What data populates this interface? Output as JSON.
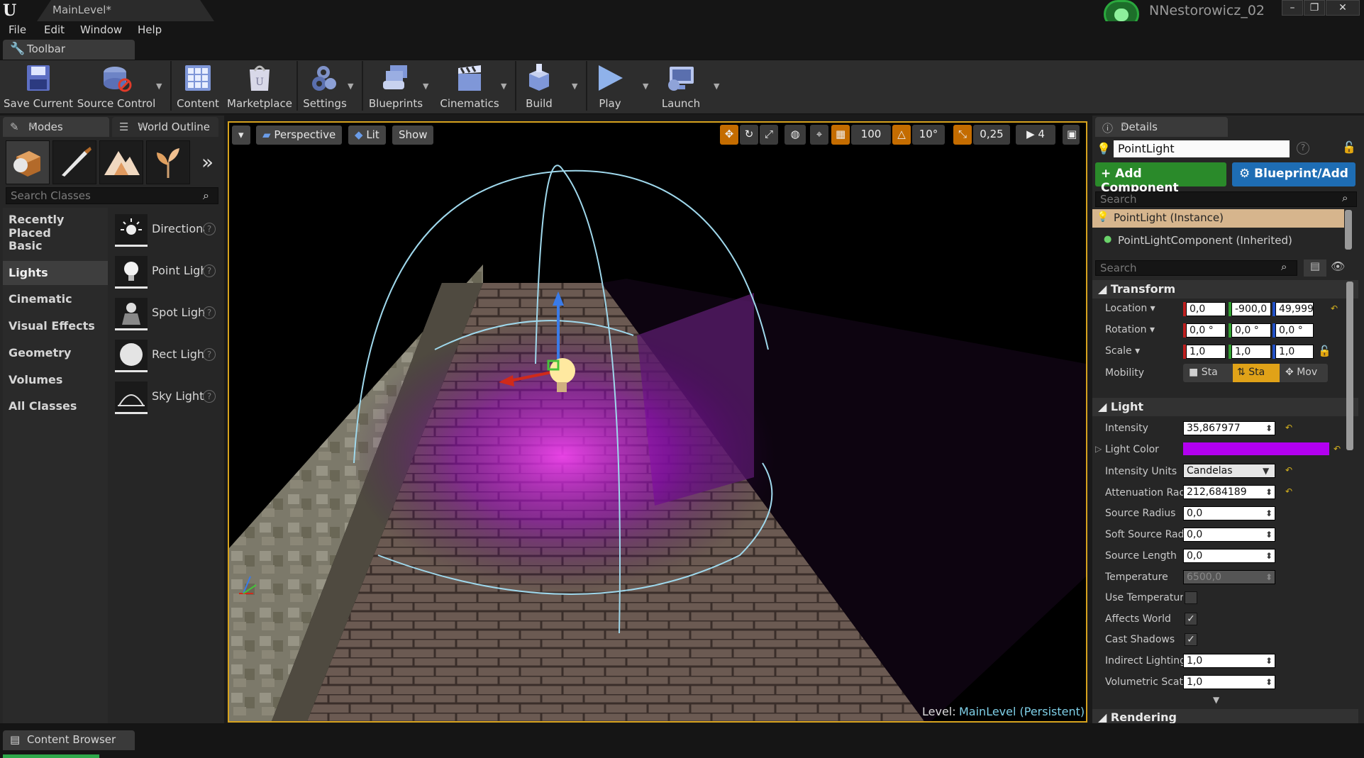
{
  "app": {
    "level_tab": "MainLevel*",
    "user_name": "NNestorowicz_02",
    "window_buttons": [
      "–",
      "❐",
      "✕"
    ]
  },
  "menu": [
    "File",
    "Edit",
    "Window",
    "Help"
  ],
  "toolbar": {
    "tab_label": "Toolbar",
    "buttons": [
      {
        "label": "Save Current",
        "icon": "save-icon"
      },
      {
        "label": "Source Control",
        "icon": "source-control-icon"
      },
      {
        "label": "Content",
        "icon": "content-icon"
      },
      {
        "label": "Marketplace",
        "icon": "marketplace-icon"
      },
      {
        "label": "Settings",
        "icon": "settings-icon"
      },
      {
        "label": "Blueprints",
        "icon": "blueprints-icon"
      },
      {
        "label": "Cinematics",
        "icon": "cinematics-icon"
      },
      {
        "label": "Build",
        "icon": "build-icon"
      },
      {
        "label": "Play",
        "icon": "play-icon"
      },
      {
        "label": "Launch",
        "icon": "launch-icon"
      }
    ]
  },
  "modes": {
    "tab_modes": "Modes",
    "tab_outliner": "World Outline",
    "search_placeholder": "Search Classes",
    "categories": [
      "Recently Placed",
      "Basic",
      "Lights",
      "Cinematic",
      "Visual Effects",
      "Geometry",
      "Volumes",
      "All Classes"
    ],
    "selected_category": "Lights",
    "lights": [
      {
        "name": "Directional Light",
        "icon": "directional-light-icon"
      },
      {
        "name": "Point Light",
        "icon": "point-light-icon"
      },
      {
        "name": "Spot Light",
        "icon": "spot-light-icon"
      },
      {
        "name": "Rect Light",
        "icon": "rect-light-icon"
      },
      {
        "name": "Sky Light",
        "icon": "sky-light-icon"
      }
    ]
  },
  "viewport": {
    "perspective": "Perspective",
    "lit": "Lit",
    "show": "Show",
    "grid_snap": "100",
    "rotate_snap": "10°",
    "scale_snap": "0,25",
    "camera_speed": "4",
    "level_label": "Level:",
    "level_name": "MainLevel (Persistent)"
  },
  "details": {
    "tab": "Details",
    "actor_name": "PointLight",
    "add_component": "+ Add Component",
    "blueprint_add": "Blueprint/Add",
    "search_placeholder": "Search",
    "components": [
      "PointLight (Instance)",
      "PointLightComponent (Inherited)"
    ],
    "transform": {
      "header": "Transform",
      "location_label": "Location",
      "location": [
        "0,0",
        "-900,0",
        "49,9999"
      ],
      "rotation_label": "Rotation",
      "rotation": [
        "0,0 °",
        "0,0 °",
        "0,0 °"
      ],
      "scale_label": "Scale",
      "scale": [
        "1,0",
        "1,0",
        "1,0"
      ],
      "mobility_label": "Mobility",
      "mobility": [
        "Sta",
        "Sta",
        "Mov"
      ]
    },
    "light": {
      "header": "Light",
      "intensity_label": "Intensity",
      "intensity": "35,867977",
      "color_label": "Light Color",
      "color": "#b200f0",
      "units_label": "Intensity Units",
      "units": "Candelas",
      "atten_label": "Attenuation Radius",
      "atten": "212,684189",
      "src_radius_label": "Source Radius",
      "src_radius": "0,0",
      "soft_src_label": "Soft Source Radius",
      "soft_src": "0,0",
      "src_len_label": "Source Length",
      "src_len": "0,0",
      "temp_label": "Temperature",
      "temp": "6500,0",
      "use_temp_label": "Use Temperature",
      "affects_label": "Affects World",
      "cast_label": "Cast Shadows",
      "indirect_label": "Indirect Lighting Intensity",
      "indirect": "1,0",
      "vol_label": "Volumetric Scattering Intensity",
      "vol": "1,0"
    },
    "rendering_header": "Rendering"
  },
  "content_browser": {
    "tab": "Content Browser"
  }
}
